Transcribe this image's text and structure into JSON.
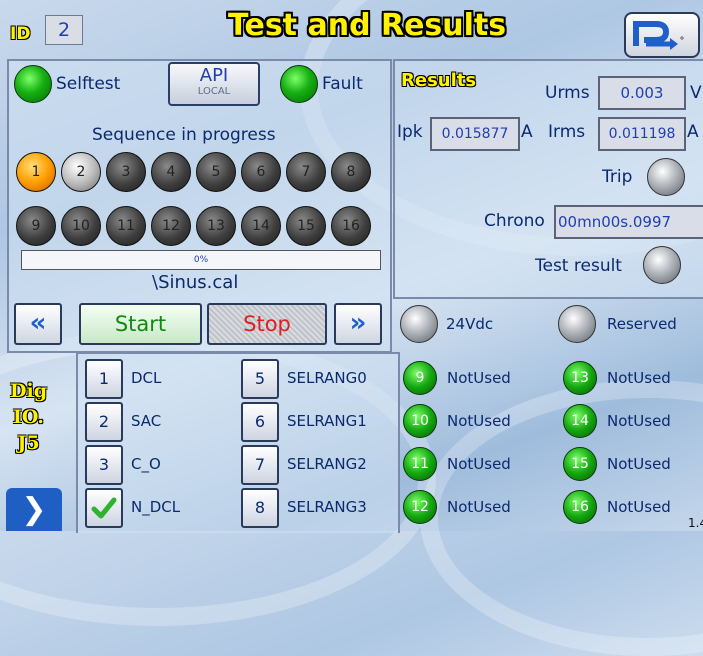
{
  "header": {
    "id_label": "ID",
    "id_value": "2",
    "title": "Test and Results"
  },
  "left": {
    "selftest_label": "Selftest",
    "api_label": "API",
    "api_sub": "LOCAL",
    "fault_label": "Fault",
    "sequence_status": "Sequence in progress",
    "steps": [
      "1",
      "2",
      "3",
      "4",
      "5",
      "6",
      "7",
      "8",
      "9",
      "10",
      "11",
      "12",
      "13",
      "14",
      "15",
      "16"
    ],
    "active_step": "1",
    "progress_text": "0%",
    "progress_value": 0,
    "file_name": "\\Sinus.cal",
    "start_label": "Start",
    "stop_label": "Stop"
  },
  "results": {
    "title": "Results",
    "urms_label": "Urms",
    "urms_value": "0.003",
    "urms_unit": "V",
    "ipk_label": "Ipk",
    "ipk_value": "0.015877",
    "ipk_unit": "A",
    "irms_label": "Irms",
    "irms_value": "0.011198",
    "irms_unit": "A",
    "trip_label": "Trip",
    "chrono_label": "Chrono",
    "chrono_value": "00mn00s.0997",
    "test_result_label": "Test result"
  },
  "io": {
    "tab_lines": [
      "Dig",
      "IO.",
      "J5"
    ],
    "power_label": "24Vdc",
    "reserved_label": "Reserved",
    "outputs": [
      {
        "num": "1",
        "name": "DCL"
      },
      {
        "num": "2",
        "name": "SAC"
      },
      {
        "num": "3",
        "name": "C_O"
      },
      {
        "num": "",
        "name": "N_DCL"
      },
      {
        "num": "5",
        "name": "SELRANG0"
      },
      {
        "num": "6",
        "name": "SELRANG1"
      },
      {
        "num": "7",
        "name": "SELRANG2"
      },
      {
        "num": "8",
        "name": "SELRANG3"
      }
    ],
    "inputs": [
      {
        "num": "9",
        "name": "NotUsed"
      },
      {
        "num": "10",
        "name": "NotUsed"
      },
      {
        "num": "11",
        "name": "NotUsed"
      },
      {
        "num": "12",
        "name": "NotUsed"
      },
      {
        "num": "13",
        "name": "NotUsed"
      },
      {
        "num": "14",
        "name": "NotUsed"
      },
      {
        "num": "15",
        "name": "NotUsed"
      },
      {
        "num": "16",
        "name": "NotUsed"
      }
    ],
    "corner_text": "1.4"
  },
  "colors": {
    "accent": "#1f5fc3",
    "title": "#fff200",
    "led_green": "#16b012",
    "active_step": "#ff9d00",
    "stop_text": "#e02020",
    "start_text": "#128a12"
  },
  "icons": [
    "app-logo-icon",
    "rewind-icon",
    "forward-icon",
    "checkmark-icon",
    "chevron-right-icon"
  ]
}
